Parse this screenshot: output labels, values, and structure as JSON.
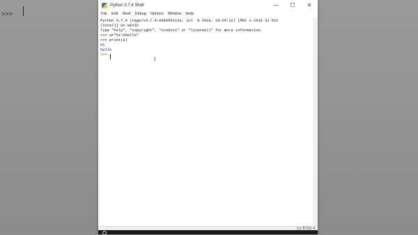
{
  "background": {
    "prompt": ">>>"
  },
  "window": {
    "title": "Python 3.7.4 Shell",
    "controls": {
      "minimize": "—",
      "maximize": "☐",
      "close": "✕"
    }
  },
  "menu": [
    "File",
    "Edit",
    "Shell",
    "Debug",
    "Options",
    "Window",
    "Help"
  ],
  "shell_lines": [
    {
      "text": "Python 3.7.4 (tags/v3.7.4:e09359112e, Jul  8 2019, 19:29:22) [MSC v.1916 32 bit",
      "kind": "normal"
    },
    {
      "text": "(Intel)] on win32",
      "kind": "normal"
    },
    {
      "text": "Type \"help\", \"copyright\", \"credits\" or \"license()\" for more information.",
      "kind": "normal"
    },
    {
      "text": ">>> a=\"hi\\nhello\"",
      "kind": "normal"
    },
    {
      "text": ">>> print(a)",
      "kind": "normal"
    },
    {
      "text": "hi",
      "kind": "out"
    },
    {
      "text": "hello",
      "kind": "out"
    },
    {
      "text": ">>> ",
      "kind": "prompt"
    }
  ],
  "status": {
    "text": "Ln: 8 Col: 4"
  },
  "colors": {
    "output": "#0000cc",
    "prompt": "#8b4513"
  }
}
